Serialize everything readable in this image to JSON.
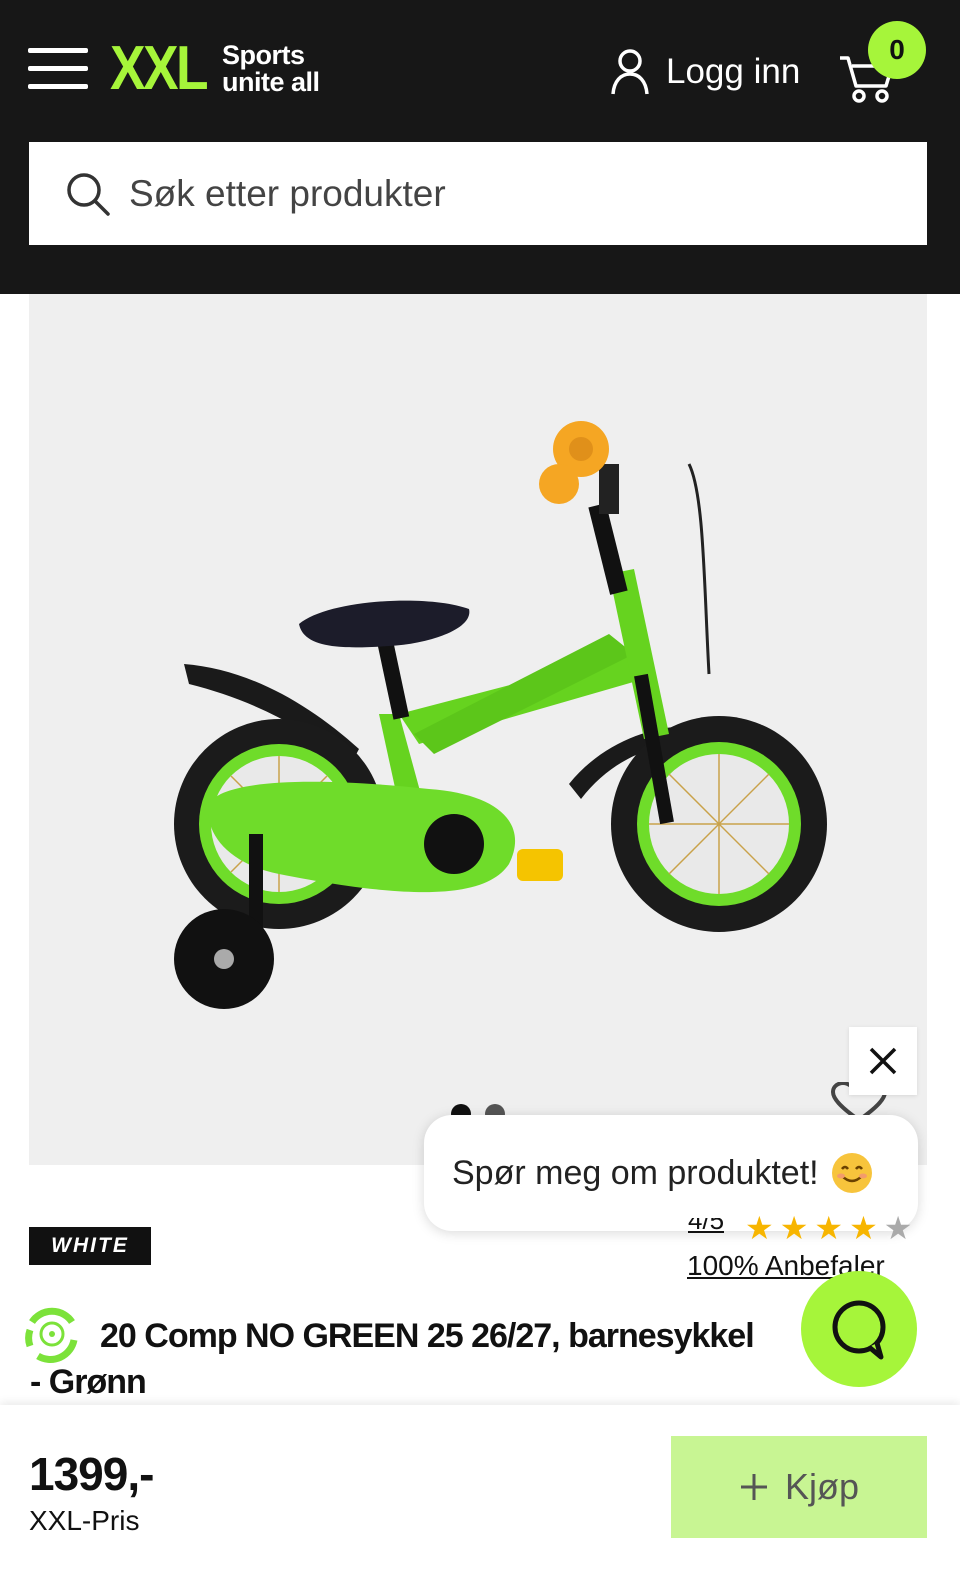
{
  "header": {
    "logo_text": "XXL",
    "logo_tagline_1": "Sports",
    "logo_tagline_2": "unite all",
    "login_label": "Logg inn",
    "cart_count": "0",
    "search_placeholder": "Søk etter produkter"
  },
  "icons": {
    "menu": "hamburger-menu-icon",
    "user": "user-icon",
    "cart": "cart-icon",
    "search": "search-icon",
    "close": "close-icon",
    "wishlist": "heart-icon",
    "chat": "chat-icon",
    "eco": "recycle-eco-icon"
  },
  "gallery": {
    "image_count": 2,
    "active_index": 0
  },
  "chat_prompt": {
    "text": "Spør meg om produktet!"
  },
  "product": {
    "brand": "WHITE",
    "rating_score": "4/5",
    "rating_stars_filled": 4,
    "rating_stars_total": 5,
    "recommend_text": "100% Anbefaler",
    "title_line_1": "20 Comp NO GREEN 25 26/27, barnesykkel",
    "title_line_2": "- Grønn",
    "price": "1399,-",
    "price_label": "XXL-Pris",
    "buy_label": "Kjøp"
  },
  "colors": {
    "header_bg": "#171717",
    "brand_green": "#a6f53a",
    "buy_button_bg": "#c8f593",
    "star": "#f7b500"
  }
}
